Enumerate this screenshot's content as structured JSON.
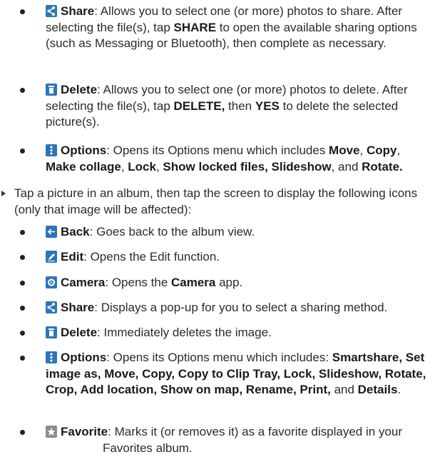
{
  "top_items": [
    {
      "icon": "share-icon",
      "term": "Share",
      "sep": ": ",
      "t1": "Allows you to select one (or more) photos to share. After selecting the file(s), tap ",
      "k1": "SHARE",
      "t2": " to open the available sharing options (such as Messaging or Bluetooth), then complete as necessary."
    },
    {
      "icon": "delete-icon",
      "term": "Delete",
      "sep": ": ",
      "t1": "Allows you to select one (or more) photos to delete. After selecting the file(s), tap ",
      "k1": "DELETE,",
      "t2": " then ",
      "k2": "YES",
      "t3": " to delete the selected picture(s)."
    },
    {
      "icon": "options-icon",
      "term": "Options",
      "sep": ": ",
      "t1": "Opens its Options menu which includes ",
      "k1": "Move",
      "t2": ", ",
      "k2": "Copy",
      "t3": ", ",
      "k3": "Make collage",
      "t4": ", ",
      "k4": "Lock",
      "t5": ", ",
      "k5": "Show locked files, Slideshow",
      "t6": ", and ",
      "k6": "Rotate."
    }
  ],
  "instruction": "Tap a picture in an album, then tap the screen to display the following icons (only that image will be affected):",
  "icon_items": [
    {
      "icon": "back-icon",
      "term": "Back",
      "sep": ": ",
      "t1": "Goes back to the album view."
    },
    {
      "icon": "edit-icon",
      "term": "Edit",
      "sep": ": ",
      "t1": "Opens the Edit function."
    },
    {
      "icon": "camera-icon",
      "term": "Camera",
      "sep": ": ",
      "t1": "Opens the ",
      "k1": "Camera",
      "t2": " app."
    },
    {
      "icon": "share-icon",
      "term": "Share",
      "sep": ": ",
      "t1": "Displays a pop-up for you to select a sharing method."
    },
    {
      "icon": "delete-icon",
      "term": "Delete",
      "sep": ": ",
      "t1": "Immediately deletes the image."
    },
    {
      "icon": "options-icon",
      "term": "Options",
      "sep": ": ",
      "t1": "Opens its Options menu which includes: ",
      "k1": "Smartshare, Set image as, Move, Copy, Copy to Clip Tray, Lock, Slideshow, Rotate, Crop, Add location, Show on map, Rename, Print,",
      "t2": " and ",
      "k2": "Details",
      "t3": "."
    },
    {
      "icon": "favorite-icon",
      "term": "Favorite",
      "sep": ": ",
      "t1": "Marks it (or removes it) as a favorite displayed in your",
      "t2": "Favorites album."
    }
  ],
  "colors": {
    "icon_blue": "#2b76b9",
    "icon_gray": "#8d8d8d",
    "text": "#2b2b2b"
  }
}
